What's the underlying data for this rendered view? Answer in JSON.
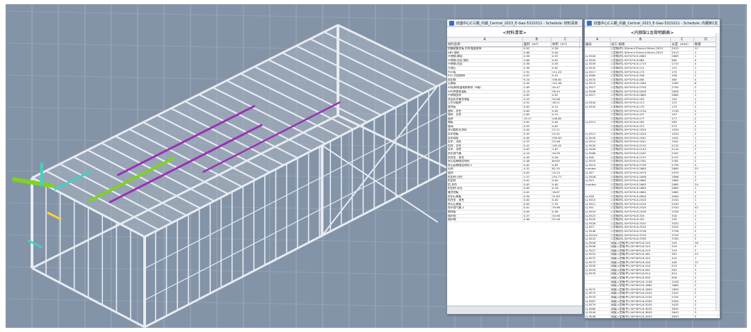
{
  "window1": {
    "title": "欣盛中心C三期_内装_Central_2023_E-Gao-5321011 - Schedule: 材料清单",
    "heading": "<材料清单>",
    "col_letters": [
      "A",
      "B",
      "C"
    ],
    "col_headers": [
      "材料名称",
      "面积（m²）",
      "体积（m³）"
    ],
    "rows": [
      [
        "铝蜂窝复合板-内外墙面装饰",
        "0.52",
        "4.26"
      ],
      [
        "ABS 塑料",
        "0.06",
        "0.00"
      ],
      [
        "不锈钢-雾面",
        "0.38",
        "0.53"
      ],
      [
        "不锈钢-拉丝 塑料",
        "0.06",
        "0.02"
      ],
      [
        "不锈钢-拉丝",
        "0.36",
        "0.03"
      ],
      [
        "大理石",
        "0.36",
        "0.02"
      ],
      [
        "PVC板",
        "2.91",
        "111.25"
      ],
      [
        "PVC-内墙装饰",
        "0.01",
        "0.25"
      ],
      [
        "成型钢",
        "9.24",
        "338.82"
      ],
      [
        "石膏板",
        "0.44",
        "122.06"
      ],
      [
        "SE岩棉保温隔热卷材（B级）",
        "2.09",
        "20.47"
      ],
      [
        "XPS挤塑保温板",
        "0.19",
        "36.44"
      ],
      [
        "不锈钢型材",
        "0.05",
        "0.05"
      ],
      [
        "多层实木复合地板",
        "0.25",
        "20.06"
      ],
      [
        "卫生间瓷砖",
        "0.52",
        "16.21"
      ],
      [
        "胶合板",
        "0.05",
        "0.14"
      ],
      [
        "塑料 - 灰色",
        "0.00",
        "0.00"
      ],
      [
        "塑料 - 白色",
        "0.00",
        "0.15"
      ],
      [
        "面砖",
        "19.17",
        "246.85"
      ],
      [
        "钢板",
        "0.02",
        "0.00"
      ],
      [
        "玻璃",
        "0.55",
        "0.63"
      ],
      [
        "多功能防水涂料",
        "0.04",
        "23.11"
      ],
      [
        "实木地板",
        "0.35",
        "25.42"
      ],
      [
        "实木线条",
        "0.49",
        "339.83"
      ],
      [
        "实木 - 浅色",
        "0.23",
        "23.46"
      ],
      [
        "铝材 - 白色",
        "0.41",
        "193.55"
      ],
      [
        "实木 - 深色",
        "0.03",
        "2.87"
      ],
      [
        "防水透气膜",
        "0.10",
        "30.59"
      ],
      [
        "铝合金 - 黑色",
        "0.39",
        "0.26"
      ],
      [
        "防火岩棉隔音材料",
        "0.48",
        "69.63"
      ],
      [
        "防火岩棉隔音材料-2",
        "0.02",
        "0.83"
      ],
      [
        "石材",
        "4.31",
        "82.35"
      ],
      [
        "管材",
        "0.05",
        "19.14"
      ],
      [
        "铝型材-白色",
        "2.57",
        "252.77"
      ],
      [
        "铝型材",
        "0.01",
        "0.00"
      ],
      [
        "铝-灰色",
        "0.03",
        "0.00"
      ],
      [
        "铝型材-亮光",
        "0.00",
        "0.16"
      ],
      [
        "复合地板",
        "0.01",
        "18.87"
      ],
      [
        "防水石膏板",
        "0.30",
        "31.63"
      ],
      [
        "铝合金 - 银色",
        "0.00",
        "0.00"
      ],
      [
        "防火石膏板",
        "0.05",
        "3.35"
      ],
      [
        "防水透气膜-2",
        "0.01",
        "19.98"
      ],
      [
        "镀锌板",
        "0.04",
        "0.36"
      ],
      [
        "隔声毡",
        "0.37",
        "34.58"
      ],
      [
        "隔声棉",
        "0.96",
        "52.28"
      ]
    ]
  },
  "window2": {
    "title": "欣盛中心C三期_内装_Central_2023_E-Gao-5321011 - Schedule: 内钢架1龙骨明细表",
    "heading": "<内钢架1龙骨明细表>",
    "col_letters": [
      "A",
      "B",
      "C",
      "D"
    ],
    "col_headers": [
      "编号",
      "加工·规格",
      "长度（mm）",
      "数量"
    ],
    "rows": [
      [
        "",
        "C型钢(中)-50mm×32mm×20mm-2913",
        "2913",
        "11"
      ],
      [
        "",
        "C型钢(中)-50mm×32mm×20mm-2913",
        "2913",
        "1"
      ],
      [
        "LJ-5500",
        "C型钢(内)-50*32*0.8-2865",
        "2865",
        "1"
      ],
      [
        "LJ-5550",
        "C型钢(内)-50*32*0.8-965",
        "965",
        "4"
      ],
      [
        "LJ-5559",
        "C型钢(内)-50*32*0.8-1715",
        "1715",
        "4"
      ],
      [
        "LJ-5542",
        "C型钢(内)-50*32*0.8-112",
        "112",
        "1"
      ],
      [
        "LJ-5517",
        "C型钢(内)-50*32*0.8-175",
        "175",
        "1"
      ],
      [
        "LJ-5560",
        "C型钢(内)-50*32*0.8-358",
        "358",
        "2"
      ],
      [
        "LJ-5570",
        "C型钢(内)-50*32*0.8-465",
        "465",
        "4"
      ],
      [
        "LJ-5574",
        "C型钢(内)-50*32*0.8-1565",
        "1565",
        "6"
      ],
      [
        "LJ-5517",
        "C型钢(内)-50*32*0.8-2795",
        "2795",
        "2"
      ],
      [
        "LJ-5508",
        "C型钢(内)-50*32*0.8-2628",
        "2628",
        "3"
      ],
      [
        "LJ-5517",
        "C型钢(内)-50*32*0.8-2865",
        "2865",
        "1"
      ],
      [
        "",
        "C型钢(内)-50*32*0.8-103",
        "103",
        "1"
      ],
      [
        "LJ-5540",
        "C型钢(内)-50*32*0.8-113",
        "113",
        "2"
      ],
      [
        "LJ-5545",
        "C型钢(内)-50*32*0.8-175",
        "175",
        "2"
      ],
      [
        "",
        "C型钢(内)-50*32*0.8-1150",
        "1150",
        "2"
      ],
      [
        "",
        "C型钢(内)-50*32*0.8-197",
        "197",
        "2"
      ],
      [
        "",
        "C型钢(内)-50*32*0.8-277",
        "277",
        "2"
      ],
      [
        "LJ-5513",
        "C型钢(内)-50*32*0.8-283",
        "283",
        "2"
      ],
      [
        "",
        "C型钢(内)-50*32*0.8-373",
        "373",
        "2"
      ],
      [
        "",
        "C型钢(内)-50*32*0.8-1034",
        "1034",
        "2"
      ],
      [
        "LJ-5512",
        "C型钢(内)-50*32*0.8-1034",
        "1034",
        "2"
      ],
      [
        "LJ-5549",
        "C型钢(内)-50*32*0.8-1941",
        "1941",
        "1"
      ],
      [
        "LJ-5514",
        "C型钢(内)-50*32*0.8-1941",
        "1941",
        "1"
      ],
      [
        "LJ-5526",
        "C型钢(内)-50*32*0.8-2132",
        "2132",
        "4"
      ],
      [
        "LJ-5509",
        "C型钢(内)-50*32*0.8-2144",
        "2144",
        "2"
      ],
      [
        "LJ-5568",
        "C型钢(内)-50*32*0.8-2167",
        "2167",
        "2"
      ],
      [
        "LJ-558",
        "C型钢(内)-50*32*0.8-2747",
        "2747",
        "2"
      ],
      [
        "LJ-5555",
        "C型钢(内)-50*32*0.8-2761",
        "2761",
        "2"
      ],
      [
        "LJ-5519",
        "C型钢(内)-50*32*0.8-2799",
        "2799",
        "3"
      ],
      [
        "number",
        "C型钢(内)-50*32*0.8-2865",
        "2865",
        "25"
      ],
      [
        "LJ-557",
        "C型钢(内)-50*32*0.8-2979",
        "2979",
        "2"
      ],
      [
        "LJ-5526",
        "C型钢(内)-50*32*0.8-1898",
        "1898",
        "2"
      ],
      [
        "LJ-553",
        "C型钢(内)-50*32*0.8-2865",
        "2865",
        "3"
      ],
      [
        "number",
        "C型钢(内)-50*32*0.8-2865",
        "2865",
        "24"
      ],
      [
        "",
        "C型钢(内)-50*32*0.8-2865",
        "2865",
        "1"
      ],
      [
        "",
        "C型钢(内)-50*32*0.8-2865",
        "2865",
        "2"
      ],
      [
        "LJ-558",
        "C型钢(内)-50*32*0.8-4900",
        "4900",
        "2"
      ],
      [
        "LJ-5515",
        "C型钢(内)-50*32*0.8-2520",
        "2520",
        "1"
      ],
      [
        "LJ-5521",
        "C型钢(内)-50*32*0.8-2520",
        "2520",
        "1"
      ],
      [
        "LJ-551",
        "C型钢(内)-50*32*0.8-2520",
        "2520",
        "42"
      ],
      [
        "LJ-5520",
        "C型钢(内)-50*32*0.8-2528",
        "2528",
        "1"
      ],
      [
        "LJ-5523",
        "C型钢(内)-50*32*0.8-316",
        "316",
        "2"
      ],
      [
        "LJ-5529",
        "C型钢(内)-50*32*0.8-355",
        "355",
        "1"
      ],
      [
        "LJ-5528",
        "C型钢(内)-50*32*0.8-3332",
        "3332",
        "1"
      ],
      [
        "LJ-553",
        "C型钢(内)-50*32*0.8-3332",
        "3332",
        "2"
      ],
      [
        "LJ-5546",
        "C型钢(内)-50*32*0.8-3726",
        "3726",
        "2"
      ],
      [
        "LJ-55104",
        "C型钢(内)-50*32*0.8-3729",
        "3729",
        "2"
      ],
      [
        "LJ-5543",
        "C型钢(内)-50*32*0.8-3783",
        "3783",
        "2"
      ],
      [
        "LJ-5558",
        "网架-c型钢(中)-50*30*0.8-245",
        "245",
        "26"
      ],
      [
        "LJ-5556",
        "网架-c型钢(中)-50*30*0.8-319",
        "319",
        "3"
      ],
      [
        "LJ-5527",
        "网架-c型钢(中)-50*30*0.8-319",
        "319",
        "3"
      ],
      [
        "LJ-5525",
        "网架-c型钢(中)-50*30*0.8-381",
        "381",
        "23"
      ],
      [
        "LJ-5572",
        "网架-c型钢(中)-50*30*0.8-424",
        "424",
        "1"
      ],
      [
        "LJ-5573",
        "网架-c型钢(中)-50*30*0.8-440",
        "440",
        "12"
      ],
      [
        "LJ-5539",
        "网架-c型钢(中)-50*30*0.8-510",
        "510",
        "3"
      ],
      [
        "LJ-5516",
        "网架-c型钢(中)-50*30*0.8-581",
        "581",
        "3"
      ],
      [
        "LJ-5578",
        "网架-c型钢(中)-50*30*0.8-914",
        "914",
        "2"
      ],
      [
        "",
        "网架-c型钢(中)-50*30*0.8-950",
        "950",
        "2"
      ],
      [
        "",
        "网架-c型钢(中)-50*30*0.8-1100",
        "1100",
        "3"
      ],
      [
        "",
        "网架-c型钢(中)-50*30*0.8-1665",
        "1665",
        "2"
      ],
      [
        "LJ-5572",
        "网架-c型钢(中)-50*30*0.8-1893",
        "1893",
        "2"
      ],
      [
        "LJ-5574",
        "网架-c型钢(中)-50*30*0.8-2542",
        "2542",
        "2"
      ],
      [
        "LJ-5575",
        "网架-c型钢(中)-50*30*0.8-2702",
        "2702",
        "2"
      ],
      [
        "LJ-5567",
        "网架-c型钢(中)-50*30*0.8-2950",
        "2950",
        "3"
      ],
      [
        "LJ-5579",
        "网架-c型钢(中)-50*30*0.8-3035",
        "3035",
        "2"
      ],
      [
        "LJ-5580",
        "网架-c型钢(中)-50*30*0.8-3635",
        "3635",
        "3"
      ],
      [
        "LJ-5549",
        "网架-c型钢(中)-50*30*0.8-3643",
        "3643",
        "3"
      ],
      [
        "LJ-5546",
        "网架-c型钢(中)-50*30*0.8-4953",
        "4953",
        "2"
      ]
    ]
  },
  "colors": {
    "viewport_bg": "#7e8fa3",
    "frame_line": "#e8ecf2",
    "pipe_purple": "#9b2fb6",
    "pipe_green": "#7ed321",
    "pipe_cyan": "#3fd3c1",
    "window_title_bg": "#e9eef5"
  },
  "icons": [
    "revit-schedule-icon"
  ]
}
